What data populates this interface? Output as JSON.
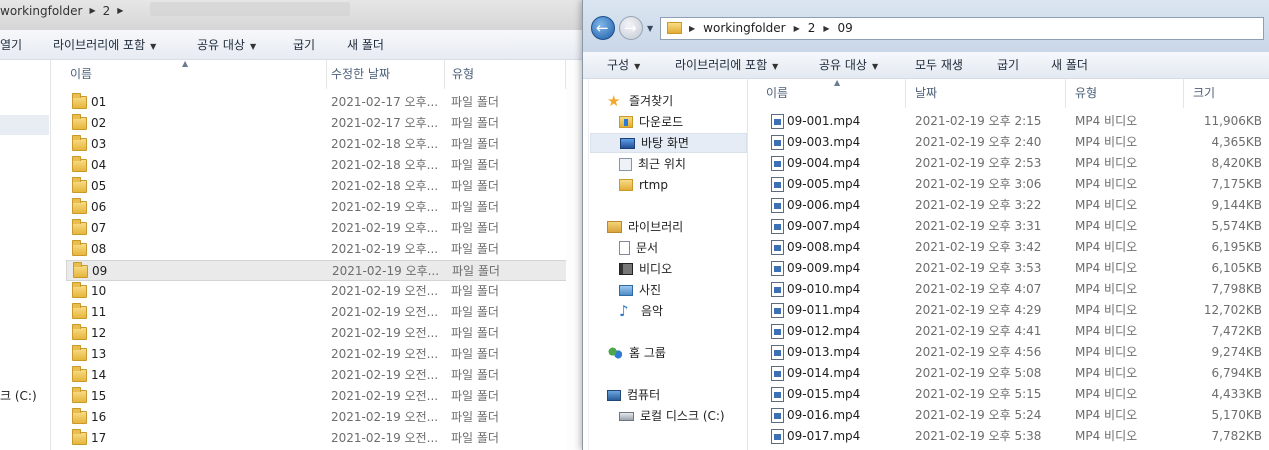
{
  "left_window": {
    "breadcrumb": [
      "workingfolder",
      "2"
    ],
    "toolbar": [
      {
        "label": "열기",
        "dropdown": false
      },
      {
        "label": "라이브러리에 포함",
        "dropdown": true
      },
      {
        "label": "공유 대상",
        "dropdown": true
      },
      {
        "label": "굽기",
        "dropdown": false
      },
      {
        "label": "새 폴더",
        "dropdown": false
      }
    ],
    "nav_drive": "크 (C:)",
    "columns": {
      "name": "이름",
      "modified": "수정한 날짜",
      "type": "유형"
    },
    "rows": [
      {
        "name": "01",
        "date": "2021-02-17 오후...",
        "type": "파일 폴더"
      },
      {
        "name": "02",
        "date": "2021-02-17 오후...",
        "type": "파일 폴더"
      },
      {
        "name": "03",
        "date": "2021-02-18 오후...",
        "type": "파일 폴더"
      },
      {
        "name": "04",
        "date": "2021-02-18 오후...",
        "type": "파일 폴더"
      },
      {
        "name": "05",
        "date": "2021-02-18 오후...",
        "type": "파일 폴더"
      },
      {
        "name": "06",
        "date": "2021-02-19 오후...",
        "type": "파일 폴더"
      },
      {
        "name": "07",
        "date": "2021-02-19 오후...",
        "type": "파일 폴더"
      },
      {
        "name": "08",
        "date": "2021-02-19 오후...",
        "type": "파일 폴더"
      },
      {
        "name": "09",
        "date": "2021-02-19 오후...",
        "type": "파일 폴더",
        "selected": true
      },
      {
        "name": "10",
        "date": "2021-02-19 오전...",
        "type": "파일 폴더"
      },
      {
        "name": "11",
        "date": "2021-02-19 오전...",
        "type": "파일 폴더"
      },
      {
        "name": "12",
        "date": "2021-02-19 오전...",
        "type": "파일 폴더"
      },
      {
        "name": "13",
        "date": "2021-02-19 오전...",
        "type": "파일 폴더"
      },
      {
        "name": "14",
        "date": "2021-02-19 오전...",
        "type": "파일 폴더"
      },
      {
        "name": "15",
        "date": "2021-02-19 오전...",
        "type": "파일 폴더"
      },
      {
        "name": "16",
        "date": "2021-02-19 오전...",
        "type": "파일 폴더"
      },
      {
        "name": "17",
        "date": "2021-02-19 오전...",
        "type": "파일 폴더"
      }
    ]
  },
  "right_window": {
    "breadcrumb": [
      "workingfolder",
      "2",
      "09"
    ],
    "toolbar": [
      {
        "label": "구성",
        "dropdown": true
      },
      {
        "label": "라이브러리에 포함",
        "dropdown": true
      },
      {
        "label": "공유 대상",
        "dropdown": true
      },
      {
        "label": "모두 재생",
        "dropdown": false
      },
      {
        "label": "굽기",
        "dropdown": false
      },
      {
        "label": "새 폴더",
        "dropdown": false
      }
    ],
    "nav": {
      "favorites": {
        "label": "즐겨찾기",
        "icon": "star-icon"
      },
      "favorite_items": [
        {
          "label": "다운로드",
          "icon": "downloads-folder-icon"
        },
        {
          "label": "바탕 화면",
          "icon": "desktop-icon",
          "selected": true
        },
        {
          "label": "최근 위치",
          "icon": "recent-places-icon"
        },
        {
          "label": "rtmp",
          "icon": "folder-icon"
        }
      ],
      "libraries": {
        "label": "라이브러리",
        "icon": "library-icon"
      },
      "library_items": [
        {
          "label": "문서",
          "icon": "document-icon"
        },
        {
          "label": "비디오",
          "icon": "video-icon"
        },
        {
          "label": "사진",
          "icon": "picture-icon"
        },
        {
          "label": "음악",
          "icon": "music-icon"
        }
      ],
      "homegroup": {
        "label": "홈 그룹",
        "icon": "homegroup-icon"
      },
      "computer": {
        "label": "컴퓨터",
        "icon": "computer-icon"
      },
      "computer_items": [
        {
          "label": "로컬 디스크 (C:)",
          "icon": "drive-icon"
        }
      ]
    },
    "columns": {
      "name": "이름",
      "date": "날짜",
      "type": "유형",
      "size": "크기"
    },
    "rows": [
      {
        "name": "09-001.mp4",
        "date": "2021-02-19 오후 2:15",
        "type": "MP4 비디오",
        "size": "11,906KB"
      },
      {
        "name": "09-003.mp4",
        "date": "2021-02-19 오후 2:40",
        "type": "MP4 비디오",
        "size": "4,365KB"
      },
      {
        "name": "09-004.mp4",
        "date": "2021-02-19 오후 2:53",
        "type": "MP4 비디오",
        "size": "8,420KB"
      },
      {
        "name": "09-005.mp4",
        "date": "2021-02-19 오후 3:06",
        "type": "MP4 비디오",
        "size": "7,175KB"
      },
      {
        "name": "09-006.mp4",
        "date": "2021-02-19 오후 3:22",
        "type": "MP4 비디오",
        "size": "9,144KB"
      },
      {
        "name": "09-007.mp4",
        "date": "2021-02-19 오후 3:31",
        "type": "MP4 비디오",
        "size": "5,574KB"
      },
      {
        "name": "09-008.mp4",
        "date": "2021-02-19 오후 3:42",
        "type": "MP4 비디오",
        "size": "6,195KB"
      },
      {
        "name": "09-009.mp4",
        "date": "2021-02-19 오후 3:53",
        "type": "MP4 비디오",
        "size": "6,105KB"
      },
      {
        "name": "09-010.mp4",
        "date": "2021-02-19 오후 4:07",
        "type": "MP4 비디오",
        "size": "7,798KB"
      },
      {
        "name": "09-011.mp4",
        "date": "2021-02-19 오후 4:29",
        "type": "MP4 비디오",
        "size": "12,702KB"
      },
      {
        "name": "09-012.mp4",
        "date": "2021-02-19 오후 4:41",
        "type": "MP4 비디오",
        "size": "7,472KB"
      },
      {
        "name": "09-013.mp4",
        "date": "2021-02-19 오후 4:56",
        "type": "MP4 비디오",
        "size": "9,274KB"
      },
      {
        "name": "09-014.mp4",
        "date": "2021-02-19 오후 5:08",
        "type": "MP4 비디오",
        "size": "6,794KB"
      },
      {
        "name": "09-015.mp4",
        "date": "2021-02-19 오후 5:15",
        "type": "MP4 비디오",
        "size": "4,433KB"
      },
      {
        "name": "09-016.mp4",
        "date": "2021-02-19 오후 5:24",
        "type": "MP4 비디오",
        "size": "5,170KB"
      },
      {
        "name": "09-017.mp4",
        "date": "2021-02-19 오후 5:38",
        "type": "MP4 비디오",
        "size": "7,782KB"
      }
    ]
  }
}
